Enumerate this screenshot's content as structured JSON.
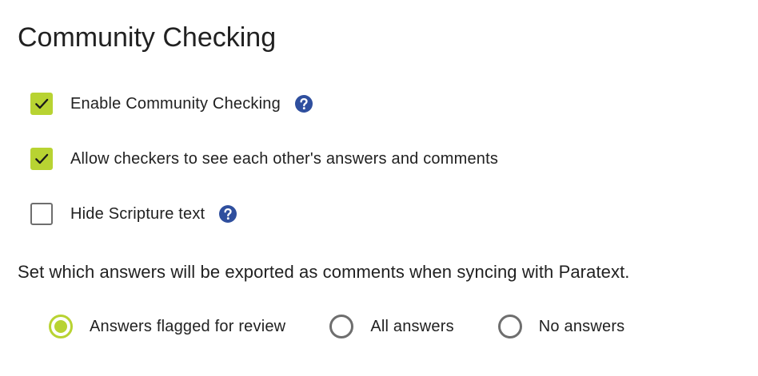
{
  "page": {
    "title": "Community Checking"
  },
  "colors": {
    "accent": "#b8d332",
    "help_icon": "#2f4f9e",
    "unchecked_border": "#6e6e6e",
    "text": "#212121"
  },
  "options": {
    "enable_checking": {
      "label": "Enable Community Checking",
      "checked": true,
      "has_help": true,
      "help_icon": "help-icon"
    },
    "see_answers": {
      "label": "Allow checkers to see each other's answers and comments",
      "checked": true,
      "has_help": false
    },
    "hide_text": {
      "label": "Hide Scripture text",
      "checked": false,
      "has_help": true,
      "help_icon": "help-icon"
    }
  },
  "export": {
    "description": "Set which answers will be exported as comments when syncing with Paratext.",
    "selected": "Answers flagged for review",
    "choices": [
      {
        "label": "Answers flagged for review",
        "selected": true
      },
      {
        "label": "All answers",
        "selected": false
      },
      {
        "label": "No answers",
        "selected": false
      }
    ]
  }
}
